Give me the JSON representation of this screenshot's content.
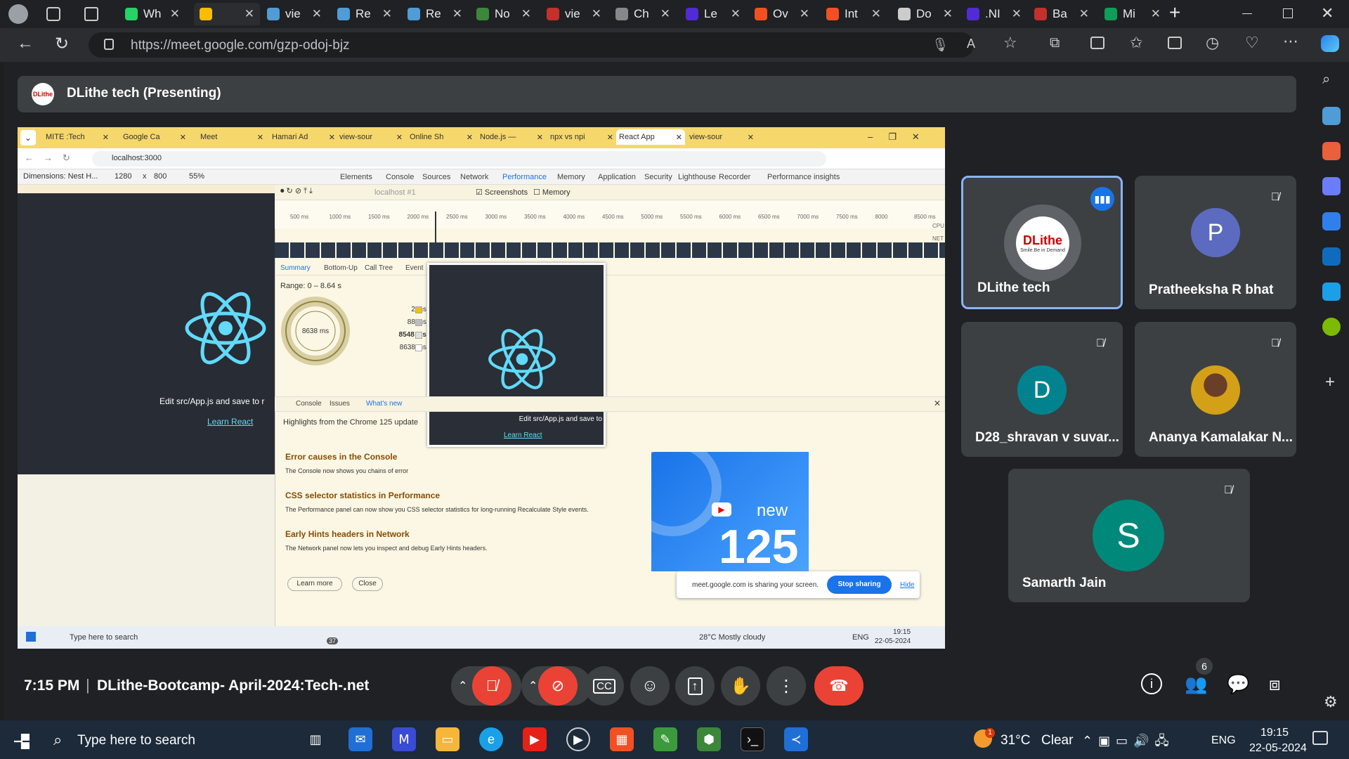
{
  "browser": {
    "tabs": [
      {
        "label": "Wh",
        "color": "#25d366"
      },
      {
        "label": "",
        "color": "#fbbc04",
        "active": true
      },
      {
        "label": "vie",
        "color": "#4f9cd6"
      },
      {
        "label": "Re",
        "color": "#4f9cd6"
      },
      {
        "label": "Re",
        "color": "#4f9cd6"
      },
      {
        "label": "No",
        "color": "#3c873a"
      },
      {
        "label": "vie",
        "color": "#c4302b"
      },
      {
        "label": "Ch",
        "color": "#888888"
      },
      {
        "label": "Le",
        "color": "#512bd4"
      },
      {
        "label": "Ov",
        "color": "#f25022"
      },
      {
        "label": "Int",
        "color": "#f25022"
      },
      {
        "label": "Do",
        "color": "#cccccc"
      },
      {
        "label": ".NI",
        "color": "#512bd4"
      },
      {
        "label": "Ba",
        "color": "#c4302b"
      },
      {
        "label": "Mi",
        "color": "#0f9d58"
      }
    ],
    "new_tab": "+",
    "url": "https://meet.google.com/gzp-odoj-bjz"
  },
  "meet": {
    "presenting_label": "DLithe tech (Presenting)",
    "presenter_logo_text": "DLithe",
    "time": "7:15 PM",
    "separator": "|",
    "meeting_name": "DLithe-Bootcamp- April-2024:Tech-.net",
    "participants_count": "6",
    "participants": [
      {
        "name": "DLithe tech",
        "initial": "DLithe",
        "tagline": "Smile.Be in Demand",
        "avatar_color": "#ffffff",
        "speaking": true
      },
      {
        "name": "Pratheeksha R bhat",
        "initial": "P",
        "avatar_color": "#5c6bc0"
      },
      {
        "name": "D28_shravan v suvar...",
        "initial": "D",
        "avatar_color": "#00838f"
      },
      {
        "name": "Ananya Kamalakar N...",
        "initial": "",
        "avatar_color": "#d4a017"
      },
      {
        "name": "Samarth Jain",
        "initial": "S",
        "avatar_color": "#00897b"
      }
    ]
  },
  "shared": {
    "tabs": [
      "MITE :Tech",
      "Google Ca",
      "Meet",
      "Hamari Ad",
      "view-sour",
      "Online Sh",
      "Node.js —",
      "npx vs npi",
      "React App",
      "view-sour"
    ],
    "url": "localhost:3000",
    "device_toolbar": {
      "dimensions": "Dimensions: Nest H...",
      "width": "1280",
      "x": "x",
      "height": "800",
      "zoom": "55%"
    },
    "devtools_tabs": [
      "Elements",
      "Console",
      "Sources",
      "Network",
      "Performance",
      "Memory",
      "Application",
      "Security",
      "Lighthouse",
      "Recorder",
      "Performance insights"
    ],
    "perf_toolbar": {
      "target": "localhost #1",
      "screenshots": "Screenshots",
      "memory": "Memory"
    },
    "ruler": [
      "500 ms",
      "1000 ms",
      "1500 ms",
      "2000 ms",
      "2500 ms",
      "3000 ms",
      "3500 ms",
      "4000 ms",
      "4500 ms",
      "5000 ms",
      "5500 ms",
      "6000 ms",
      "6500 ms",
      "7000 ms",
      "7500 ms",
      "8000",
      "8500 ms"
    ],
    "cpu": "CPU",
    "net": "NET",
    "summary_tabs": [
      "Summary",
      "Bottom-Up",
      "Call Tree",
      "Event"
    ],
    "range": "Range: 0 – 8.64 s",
    "donut_center": "8638 ms",
    "legend": [
      {
        "value": "2 ms",
        "color": "#f2c200"
      },
      {
        "value": "88 ms",
        "color": "#bdbdbd"
      },
      {
        "value": "8548 ms",
        "color": "#e0e0e0",
        "bold": true
      },
      {
        "value": "8638 ms",
        "color": "#ffffff"
      }
    ],
    "app_text": "Edit src/App.js and save to r",
    "app_link": "Learn React",
    "popup_text": "Edit src/App.js and save to",
    "popup_link": "Learn React",
    "drawer_tabs": [
      "Console",
      "Issues",
      "What's new"
    ],
    "whatsnew_headline": "Highlights from the Chrome 125 update",
    "features": [
      {
        "title": "Error causes in the Console",
        "desc": "The Console now shows you chains of error"
      },
      {
        "title": "CSS selector statistics in Performance",
        "desc": "The Performance panel can now show you CSS selector statistics for long-running Recalculate Style events."
      },
      {
        "title": "Early Hints headers in Network",
        "desc": "The Network panel now lets you inspect and debug Early Hints headers."
      }
    ],
    "learn_more": "Learn more",
    "close": "Close",
    "promo_new": "new",
    "promo_version": "125",
    "sharing_text": "meet.google.com is sharing your screen.",
    "stop_sharing": "Stop sharing",
    "hide": "Hide",
    "taskbar_search": "Type here to search",
    "weather": "28°C  Mostly cloudy",
    "lang": "ENG",
    "time": "19:15",
    "date": "22-05-2024",
    "mail_badge": "37"
  },
  "taskbar": {
    "search": "Type here to search",
    "temp": "31°C",
    "weather": "Clear",
    "weather_badge": "1",
    "lang": "ENG",
    "time": "19:15",
    "date": "22-05-2024"
  }
}
